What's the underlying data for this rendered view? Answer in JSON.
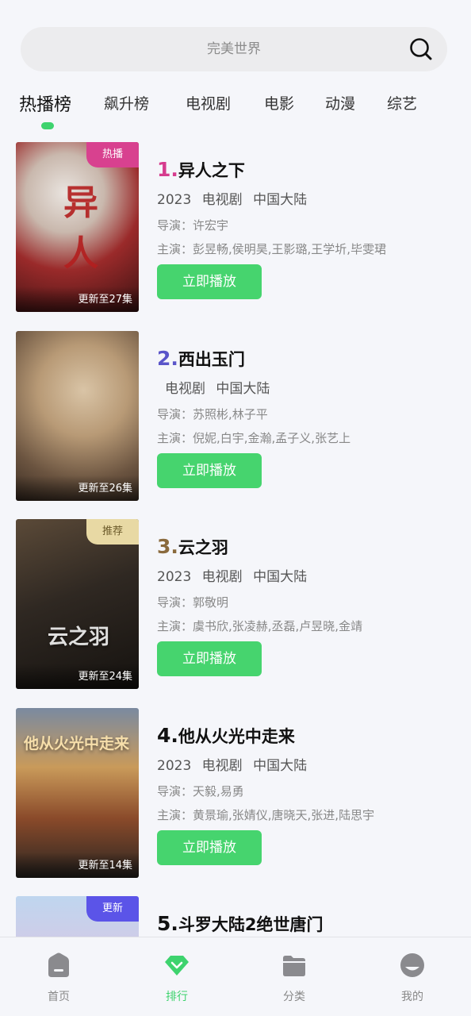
{
  "search": {
    "placeholder": "完美世界",
    "icon": "search-icon"
  },
  "tabs": [
    {
      "label": "热播榜",
      "active": true
    },
    {
      "label": "飙升榜",
      "active": false
    },
    {
      "label": "电视剧",
      "active": false
    },
    {
      "label": "电影",
      "active": false
    },
    {
      "label": "动漫",
      "active": false
    },
    {
      "label": "综艺",
      "active": false
    }
  ],
  "accent_color": "#46d46e",
  "items": [
    {
      "rank": "1.",
      "rank_color": "#d63c8e",
      "title": "异人之下",
      "year": "2023",
      "type": "电视剧",
      "region": "中国大陆",
      "director": "导演：许宏宇",
      "cast": "主演：彭昱畅,侯明昊,王影璐,王学圻,毕雯珺",
      "play": "立即播放",
      "episodes": "更新至27集",
      "badge": "热播",
      "badge_color": "#d8418f"
    },
    {
      "rank": "2.",
      "rank_color": "#5a55c9",
      "title": "西出玉门",
      "year": "",
      "type": "电视剧",
      "region": "中国大陆",
      "director": "导演：苏照彬,林子平",
      "cast": "主演：倪妮,白宇,金瀚,孟子义,张艺上",
      "play": "立即播放",
      "episodes": "更新至26集",
      "badge": "",
      "badge_color": ""
    },
    {
      "rank": "3.",
      "rank_color": "#8a6a3d",
      "title": "云之羽",
      "year": "2023",
      "type": "电视剧",
      "region": "中国大陆",
      "director": "导演：郭敬明",
      "cast": "主演：虞书欣,张凌赫,丞磊,卢昱晓,金靖",
      "play": "立即播放",
      "episodes": "更新至24集",
      "badge": "推荐",
      "badge_color": "#e8d9a4"
    },
    {
      "rank": "4.",
      "rank_color": "#111111",
      "title": "他从火光中走来",
      "year": "2023",
      "type": "电视剧",
      "region": "中国大陆",
      "director": "导演：天毅,易勇",
      "cast": "主演：黄景瑜,张婧仪,唐晓天,张进,陆思宇",
      "play": "立即播放",
      "episodes": "更新至14集",
      "badge": "",
      "badge_color": ""
    },
    {
      "rank": "5.",
      "rank_color": "#111111",
      "title": "斗罗大陆2绝世唐门",
      "year": "",
      "type": "",
      "region": "",
      "director": "",
      "cast": "",
      "play": "",
      "episodes": "",
      "badge": "更新",
      "badge_color": "#5b54e8"
    }
  ],
  "poster_titles": [
    "",
    "",
    "云之羽",
    "他从火光中走来"
  ],
  "nav": [
    {
      "label": "首页",
      "icon": "home-icon",
      "active": false
    },
    {
      "label": "排行",
      "icon": "ranking-icon",
      "active": true
    },
    {
      "label": "分类",
      "icon": "folder-icon",
      "active": false
    },
    {
      "label": "我的",
      "icon": "profile-icon",
      "active": false
    }
  ]
}
